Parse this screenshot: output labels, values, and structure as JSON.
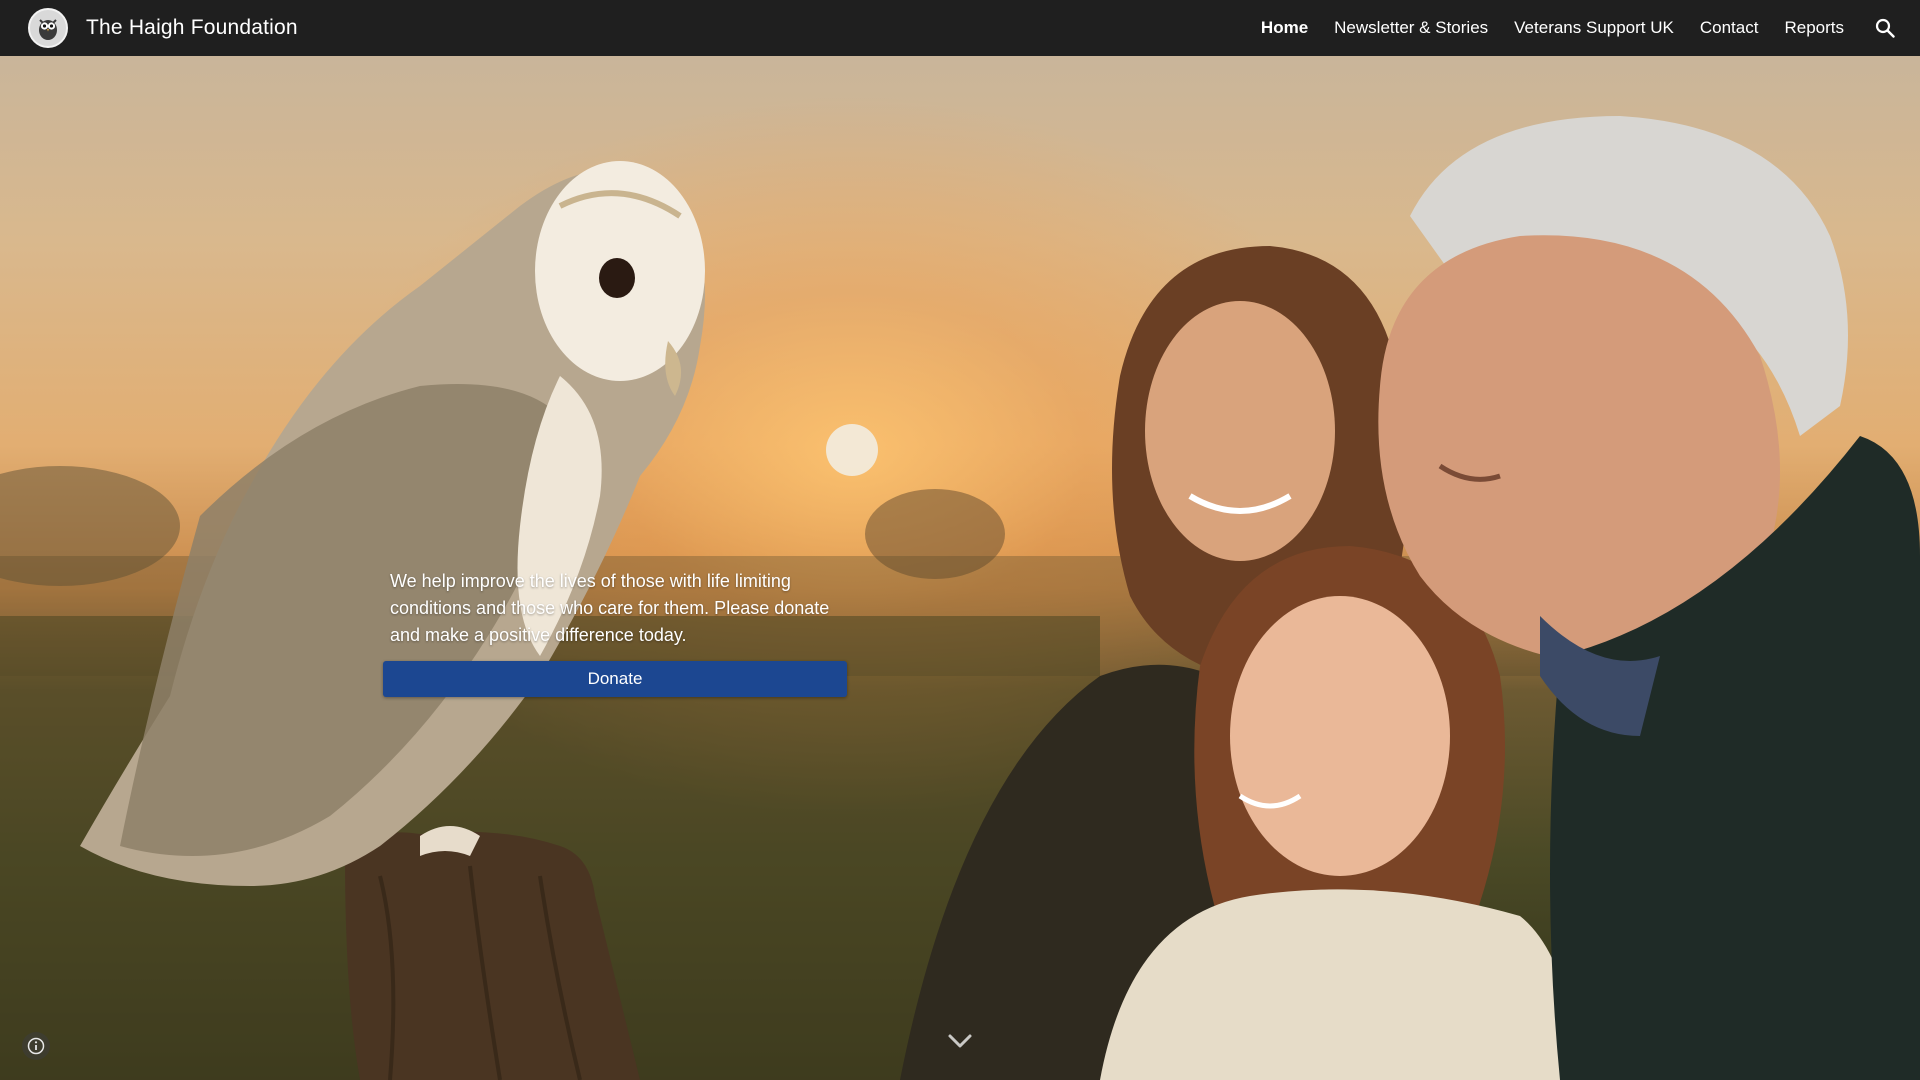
{
  "header": {
    "site_title": "The Haigh Foundation",
    "logo_icon": "owl-logo-icon"
  },
  "nav": {
    "items": [
      {
        "label": "Home",
        "active": true
      },
      {
        "label": "Newsletter & Stories",
        "active": false
      },
      {
        "label": "Veterans Support UK",
        "active": false
      },
      {
        "label": "Contact",
        "active": false
      },
      {
        "label": "Reports",
        "active": false
      }
    ],
    "search_icon": "search-icon"
  },
  "hero": {
    "tagline": "We help improve the lives of those with life limiting conditions and those who care for them. Please donate and make a positive difference today.",
    "donate_label": "Donate",
    "scroll_icon": "chevron-down-icon",
    "info_icon": "info-icon"
  },
  "colors": {
    "nav_bg": "#1f1f1f",
    "donate_bg": "#1c4791",
    "text": "#ffffff"
  }
}
